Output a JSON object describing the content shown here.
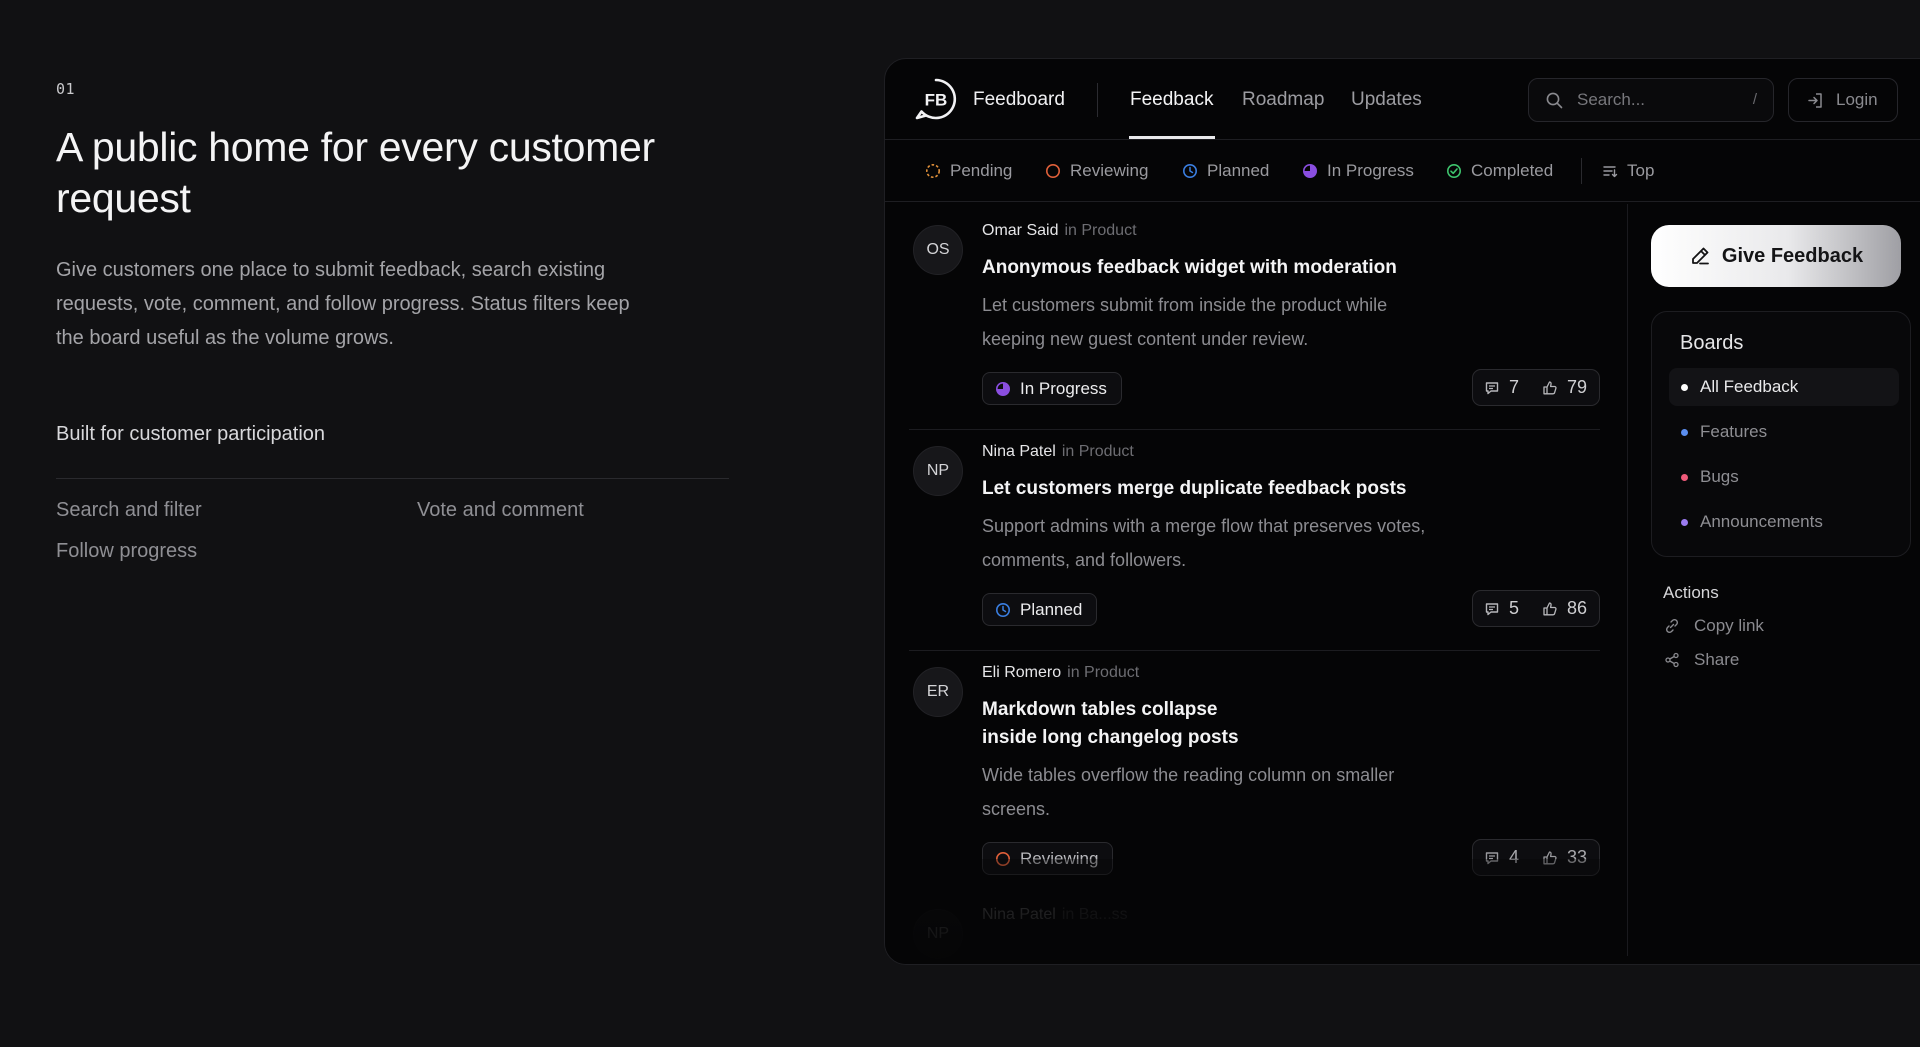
{
  "intro": {
    "number": "01",
    "title": "A public home for every customer request",
    "description": "Give customers one place to submit feedback, search existing requests, vote, comment, and follow progress. Status filters keep the board useful as the volume grows.",
    "built_for": "Built for customer participation",
    "features": [
      "Search and filter",
      "Vote and comment",
      "Follow progress"
    ]
  },
  "app": {
    "brand": "Feedboard",
    "nav": [
      {
        "label": "Feedback",
        "active": true
      },
      {
        "label": "Roadmap",
        "active": false
      },
      {
        "label": "Updates",
        "active": false
      }
    ],
    "search": {
      "placeholder": "Search...",
      "shortcut": "/"
    },
    "login_label": "Login",
    "filters": [
      {
        "label": "Pending",
        "icon": "dashed-circle-icon",
        "color": "#e0903a"
      },
      {
        "label": "Reviewing",
        "icon": "circle-icon",
        "color": "#e0603a"
      },
      {
        "label": "Planned",
        "icon": "clock-icon",
        "color": "#3a7ee0"
      },
      {
        "label": "In Progress",
        "icon": "half-circle-icon",
        "color": "#8a4ee0"
      },
      {
        "label": "Completed",
        "icon": "check-circle-icon",
        "color": "#3ec46d"
      },
      {
        "label": "Top",
        "icon": "sort-icon",
        "color": "#9a9a9f"
      }
    ],
    "posts": [
      {
        "initials": "OS",
        "author": "Omar Said",
        "board": "in Product",
        "title": "Anonymous feedback widget with moderation",
        "description": "Let customers submit from inside the product while keeping new guest content under review.",
        "status": "In Progress",
        "comments": "7",
        "votes": "79"
      },
      {
        "initials": "NP",
        "author": "Nina Patel",
        "board": "in Product",
        "title": "Let customers merge duplicate feedback posts",
        "description": "Support admins with a merge flow that preserves votes, comments, and followers.",
        "status": "Planned",
        "comments": "5",
        "votes": "86"
      },
      {
        "initials": "ER",
        "author": "Eli Romero",
        "board": "in Product",
        "title": "Markdown tables collapse inside long changelog posts",
        "description": "Wide tables overflow the reading column on smaller screens.",
        "status": "Reviewing",
        "comments": "4",
        "votes": "33"
      },
      {
        "initials": "NP",
        "author": "Nina Patel",
        "board": "in Ba...ss"
      }
    ],
    "sidebar": {
      "give_feedback": "Give Feedback",
      "boards_title": "Boards",
      "boards": [
        {
          "label": "All Feedback",
          "color": "#ffffff",
          "active": true
        },
        {
          "label": "Features",
          "color": "#5b8ef0",
          "active": false
        },
        {
          "label": "Bugs",
          "color": "#ef5a7a",
          "active": false
        },
        {
          "label": "Announcements",
          "color": "#9b7bf0",
          "active": false
        }
      ],
      "actions_title": "Actions",
      "actions": [
        {
          "label": "Copy link",
          "icon": "link-icon"
        },
        {
          "label": "Share",
          "icon": "share-icon"
        }
      ]
    }
  }
}
